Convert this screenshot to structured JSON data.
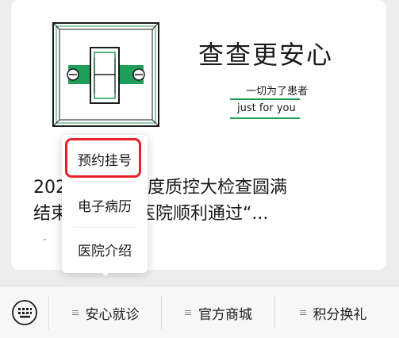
{
  "brand": {
    "title": "查查更安心",
    "slogan_cn": "一切为了患者",
    "slogan_en": "just for you"
  },
  "article": {
    "title_line1": "2022年医疗年度质控大检查圆满",
    "title_line2": "结束，济口腔医院顺利通过“...",
    "meta": "-"
  },
  "popup": {
    "items": [
      {
        "label": "预约挂号"
      },
      {
        "label": "电子病历"
      },
      {
        "label": "医院介绍"
      }
    ]
  },
  "menubar": {
    "keyboard_icon": "keyboard-icon",
    "items": [
      {
        "label": "安心就诊",
        "icon": "menu-lines-icon"
      },
      {
        "label": "官方商城",
        "icon": "menu-lines-icon"
      },
      {
        "label": "积分换礼",
        "icon": "menu-lines-icon"
      }
    ]
  },
  "colors": {
    "accent_green": "#1f9e5a",
    "highlight_red": "#e8202a"
  }
}
